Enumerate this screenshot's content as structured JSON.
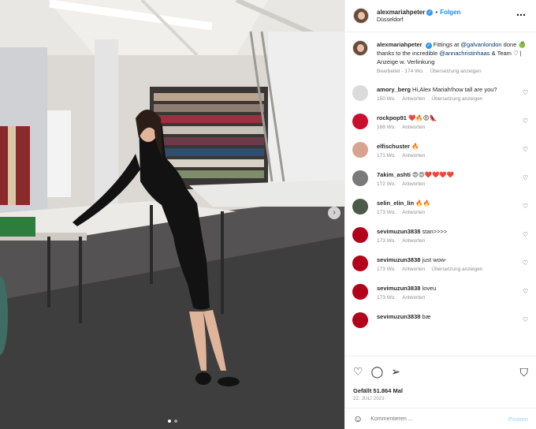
{
  "header": {
    "username": "alexmariahpeter",
    "follow_label": "Folgen",
    "separator": "•",
    "location": "Düsseldorf",
    "more_icon": "⋯"
  },
  "caption": {
    "username": "alexmariahpeter",
    "parts": [
      "Fittings at ",
      "@galvanlondon",
      " done 🍏 thanks to the incredible ",
      "@annachristinhaas",
      " & Team ♡ | Anzeige w. Verlinkung"
    ],
    "edited": "Bearbeitet",
    "time": "174 Wo.",
    "translate": "Übersetzung anzeigen"
  },
  "comments": [
    {
      "username": "amory_berg",
      "text": "Hi,Alex Mariah!how tall are you?",
      "time": "150 Wo.",
      "reply": "Antworten",
      "translate": "Übersetzung anzeigen",
      "avatar_color": "#dbdbdb"
    },
    {
      "username": "rockpop91",
      "text": "❤️🔥😍👠",
      "time": "168 Wo.",
      "reply": "Antworten",
      "translate": "",
      "avatar_color": "#c8102e"
    },
    {
      "username": "elfischuster",
      "text": "🔥",
      "time": "171 Wo.",
      "reply": "Antworten",
      "translate": "",
      "avatar_color": "#d9a48f"
    },
    {
      "username": "7akim_ashti",
      "text": "😍😍❤️❤️❤️❤️",
      "time": "172 Wo.",
      "reply": "Antworten",
      "translate": "",
      "avatar_color": "#7a7a7a"
    },
    {
      "username": "selin_elin_lin",
      "text": "🔥🔥",
      "time": "173 Wo.",
      "reply": "Antworten",
      "translate": "",
      "avatar_color": "#4b5a4b"
    },
    {
      "username": "sevimuzun3838",
      "text": "stan>>>>",
      "time": "173 Wo.",
      "reply": "Antworten",
      "translate": "",
      "avatar_color": "#b3001b"
    },
    {
      "username": "sevimuzun3838",
      "text": "just wow-",
      "time": "173 Wo.",
      "reply": "Antworten",
      "translate": "Übersetzung anzeigen",
      "avatar_color": "#b3001b"
    },
    {
      "username": "sevimuzun3838",
      "text": "loveu",
      "time": "173 Wo.",
      "reply": "Antworten",
      "translate": "",
      "avatar_color": "#b3001b"
    },
    {
      "username": "sevimuzun3838",
      "text": "bæ",
      "time": "",
      "reply": "",
      "translate": "",
      "avatar_color": "#b3001b"
    }
  ],
  "actions": {
    "like_icon": "♡",
    "comment_icon": "◯",
    "share_icon": "➢",
    "bookmark_icon": "⛉"
  },
  "likes_label": "Gefällt 51.864 Mal",
  "date_label": "22. Juli 2021",
  "comment_box": {
    "emoji_icon": "☺",
    "placeholder": "Kommentieren ...",
    "post_label": "Posten"
  },
  "colors": {
    "accent": "#0095f6",
    "verified": "#3897f0",
    "muted": "#8e8e8e"
  }
}
